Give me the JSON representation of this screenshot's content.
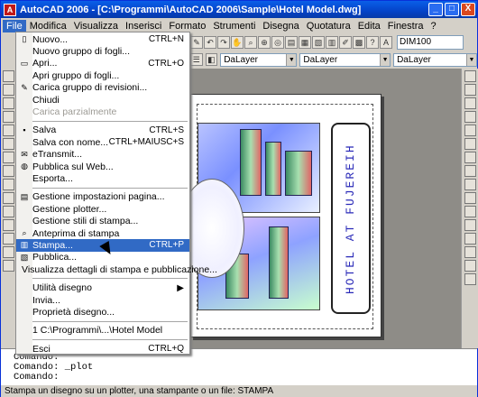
{
  "window": {
    "title": "AutoCAD 2006 - [C:\\Programmi\\AutoCAD 2006\\Sample\\Hotel Model.dwg]",
    "controls": [
      "_",
      "□",
      "X"
    ]
  },
  "menubar": {
    "items": [
      "File",
      "Modifica",
      "Visualizza",
      "Inserisci",
      "Formato",
      "Strumenti",
      "Disegna",
      "Quotatura",
      "Edita",
      "Finestra",
      "?"
    ]
  },
  "toolbar": {
    "dimstyle": "DIM100",
    "layer1": "DaLayer",
    "layer2": "DaLayer",
    "layer3": "DaLayer"
  },
  "drawing": {
    "vertical_title": "HOTEL AT FUJEREIH"
  },
  "file_menu": {
    "items": [
      {
        "label": "Nuovo...",
        "shortcut": "CTRL+N",
        "icon": "new-file-icon",
        "disabled": false
      },
      {
        "label": "Nuovo gruppo di fogli...",
        "shortcut": "",
        "icon": "",
        "disabled": false
      },
      {
        "label": "Apri...",
        "shortcut": "CTRL+O",
        "icon": "open-folder-icon",
        "disabled": false
      },
      {
        "label": "Apri gruppo di fogli...",
        "shortcut": "",
        "icon": "",
        "disabled": false
      },
      {
        "label": "Carica gruppo di revisioni...",
        "shortcut": "",
        "icon": "markup-icon",
        "disabled": false
      },
      {
        "label": "Chiudi",
        "shortcut": "",
        "icon": "",
        "disabled": false
      },
      {
        "label": "Carica parzialmente",
        "shortcut": "",
        "icon": "",
        "disabled": true
      },
      {
        "sep": true
      },
      {
        "label": "Salva",
        "shortcut": "CTRL+S",
        "icon": "save-icon",
        "disabled": false
      },
      {
        "label": "Salva con nome...",
        "shortcut": "CTRL+MAIUSC+S",
        "icon": "",
        "disabled": false
      },
      {
        "label": "eTransmit...",
        "shortcut": "",
        "icon": "etransmit-icon",
        "disabled": false
      },
      {
        "label": "Pubblica sul Web...",
        "shortcut": "",
        "icon": "web-icon",
        "disabled": false
      },
      {
        "label": "Esporta...",
        "shortcut": "",
        "icon": "",
        "disabled": false
      },
      {
        "sep": true
      },
      {
        "label": "Gestione impostazioni pagina...",
        "shortcut": "",
        "icon": "page-setup-icon",
        "disabled": false
      },
      {
        "label": "Gestione plotter...",
        "shortcut": "",
        "icon": "",
        "disabled": false
      },
      {
        "label": "Gestione stili di stampa...",
        "shortcut": "",
        "icon": "",
        "disabled": false
      },
      {
        "label": "Anteprima di stampa",
        "shortcut": "",
        "icon": "preview-icon",
        "disabled": false
      },
      {
        "label": "Stampa...",
        "shortcut": "CTRL+P",
        "icon": "print-icon",
        "disabled": false,
        "highlight": true
      },
      {
        "label": "Pubblica...",
        "shortcut": "",
        "icon": "publish-icon",
        "disabled": false
      },
      {
        "label": "Visualizza dettagli di stampa e pubblicazione...",
        "shortcut": "",
        "icon": "",
        "disabled": false
      },
      {
        "sep": true
      },
      {
        "label": "Utilità disegno",
        "shortcut": "▶",
        "icon": "",
        "disabled": false
      },
      {
        "label": "Invia...",
        "shortcut": "",
        "icon": "",
        "disabled": false
      },
      {
        "label": "Proprietà disegno...",
        "shortcut": "",
        "icon": "",
        "disabled": false
      },
      {
        "sep": true
      },
      {
        "label": "1 C:\\Programmi\\...\\Hotel Model",
        "shortcut": "",
        "icon": "",
        "disabled": false
      },
      {
        "sep": true
      },
      {
        "label": "Esci",
        "shortcut": "CTRL+Q",
        "icon": "",
        "disabled": false
      }
    ]
  },
  "command_lines": [
    "Comando:",
    "Comando: _plot",
    "Comando:"
  ],
  "statusbar": {
    "text": "Stampa un disegno su un plotter, una stampante o un file: STAMPA"
  }
}
